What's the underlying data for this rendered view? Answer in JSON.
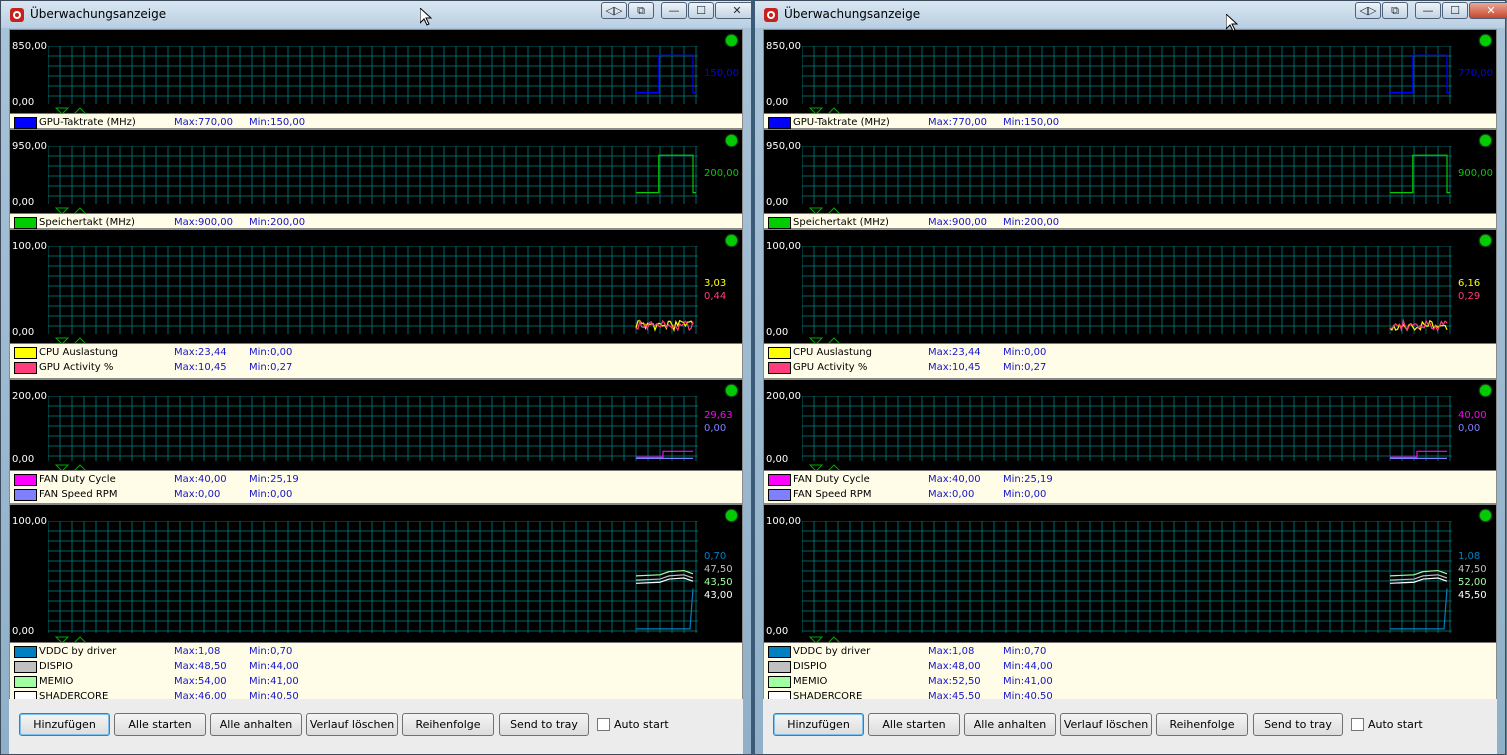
{
  "colors": {
    "gpu_clock": "#0000ff",
    "mem_clock": "#00cc00",
    "cpu": "#ffff00",
    "gpu_act": "#ff3c7c",
    "fan_duty": "#ff00ff",
    "fan_rpm": "#8080ff",
    "vddc": "#0080c0",
    "dispio": "#c0c0c0",
    "memio": "#a0ffa0",
    "shadercore": "#ffffff",
    "grid": "#008080",
    "led": "#00cc00"
  },
  "windows": [
    {
      "title": "Überwachungsanzeige",
      "panels": [
        {
          "ymax": "850,00",
          "ymin": "0,00",
          "series": [
            {
              "name": "GPU-Taktrate (MHz)",
              "color_key": "gpu_clock",
              "max": "Max:770,00",
              "min": "Min:150,00",
              "current": "150,00"
            }
          ]
        },
        {
          "ymax": "950,00",
          "ymin": "0,00",
          "series": [
            {
              "name": "Speichertakt (MHz)",
              "color_key": "mem_clock",
              "max": "Max:900,00",
              "min": "Min:200,00",
              "current": "200,00"
            }
          ]
        },
        {
          "ymax": "100,00",
          "ymin": "0,00",
          "series": [
            {
              "name": "CPU Auslastung",
              "color_key": "cpu",
              "max": "Max:23,44",
              "min": "Min:0,00",
              "current": "3,03"
            },
            {
              "name": "GPU Activity %",
              "color_key": "gpu_act",
              "max": "Max:10,45",
              "min": "Min:0,27",
              "current": "0,44"
            }
          ]
        },
        {
          "ymax": "200,00",
          "ymin": "0,00",
          "series": [
            {
              "name": "FAN Duty Cycle",
              "color_key": "fan_duty",
              "max": "Max:40,00",
              "min": "Min:25,19",
              "current": "29,63"
            },
            {
              "name": "FAN Speed RPM",
              "color_key": "fan_rpm",
              "max": "Max:0,00",
              "min": "Min:0,00",
              "current": "0,00"
            }
          ]
        },
        {
          "ymax": "100,00",
          "ymin": "0,00",
          "series": [
            {
              "name": "VDDC by driver",
              "color_key": "vddc",
              "max": "Max:1,08",
              "min": "Min:0,70",
              "current": "0,70"
            },
            {
              "name": "DISPIO",
              "color_key": "dispio",
              "max": "Max:48,50",
              "min": "Min:44,00",
              "current": "47,50"
            },
            {
              "name": "MEMIO",
              "color_key": "memio",
              "max": "Max:54,00",
              "min": "Min:41,00",
              "current": "43,50"
            },
            {
              "name": "SHADERCORE",
              "color_key": "shadercore",
              "max": "Max:46,00",
              "min": "Min:40,50",
              "current": "43,00"
            }
          ]
        }
      ],
      "buttons": [
        "Hinzufügen",
        "Alle starten",
        "Alle anhalten",
        "Verlauf löschen",
        "Reihenfolge",
        "Send to tray"
      ],
      "checkbox_label": "Auto start"
    },
    {
      "title": "Überwachungsanzeige",
      "panels": [
        {
          "ymax": "850,00",
          "ymin": "0,00",
          "series": [
            {
              "name": "GPU-Taktrate (MHz)",
              "color_key": "gpu_clock",
              "max": "Max:770,00",
              "min": "Min:150,00",
              "current": "770,00"
            }
          ]
        },
        {
          "ymax": "950,00",
          "ymin": "0,00",
          "series": [
            {
              "name": "Speichertakt (MHz)",
              "color_key": "mem_clock",
              "max": "Max:900,00",
              "min": "Min:200,00",
              "current": "900,00"
            }
          ]
        },
        {
          "ymax": "100,00",
          "ymin": "0,00",
          "series": [
            {
              "name": "CPU Auslastung",
              "color_key": "cpu",
              "max": "Max:23,44",
              "min": "Min:0,00",
              "current": "6,16"
            },
            {
              "name": "GPU Activity %",
              "color_key": "gpu_act",
              "max": "Max:10,45",
              "min": "Min:0,27",
              "current": "0,29"
            }
          ]
        },
        {
          "ymax": "200,00",
          "ymin": "0,00",
          "series": [
            {
              "name": "FAN Duty Cycle",
              "color_key": "fan_duty",
              "max": "Max:40,00",
              "min": "Min:25,19",
              "current": "40,00"
            },
            {
              "name": "FAN Speed RPM",
              "color_key": "fan_rpm",
              "max": "Max:0,00",
              "min": "Min:0,00",
              "current": "0,00"
            }
          ]
        },
        {
          "ymax": "100,00",
          "ymin": "0,00",
          "series": [
            {
              "name": "VDDC by driver",
              "color_key": "vddc",
              "max": "Max:1,08",
              "min": "Min:0,70",
              "current": "1,08"
            },
            {
              "name": "DISPIO",
              "color_key": "dispio",
              "max": "Max:48,00",
              "min": "Min:44,00",
              "current": "47,50"
            },
            {
              "name": "MEMIO",
              "color_key": "memio",
              "max": "Max:52,50",
              "min": "Min:41,00",
              "current": "52,00"
            },
            {
              "name": "SHADERCORE",
              "color_key": "shadercore",
              "max": "Max:45,50",
              "min": "Min:40,50",
              "current": "45,50"
            }
          ]
        }
      ],
      "buttons": [
        "Hinzufügen",
        "Alle starten",
        "Alle anhalten",
        "Verlauf löschen",
        "Reihenfolge",
        "Send to tray"
      ],
      "checkbox_label": "Auto start"
    }
  ]
}
